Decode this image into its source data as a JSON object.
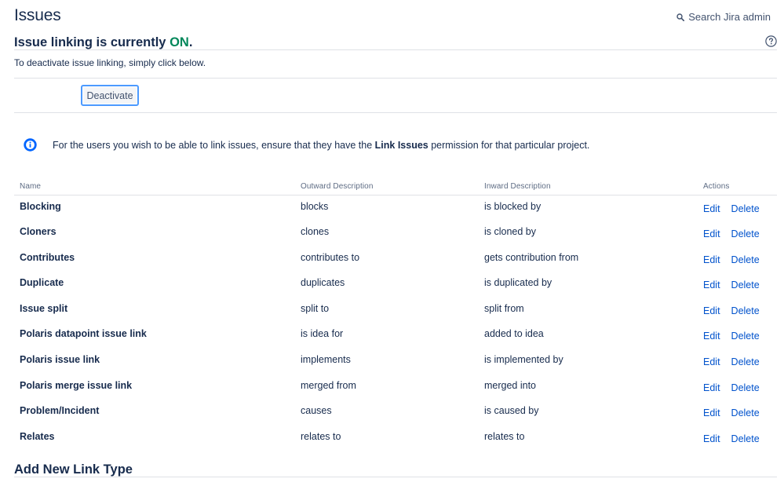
{
  "header": {
    "title": "Issues",
    "search_label": "Search Jira admin",
    "search_icon": "search-icon"
  },
  "linking": {
    "heading_prefix": "Issue linking is currently ",
    "status": "ON",
    "heading_suffix": ".",
    "status_color": "#00875a",
    "help_icon": "question-circle-icon",
    "instruction": "To deactivate issue linking, simply click below.",
    "deactivate_label": "Deactivate"
  },
  "info": {
    "icon": "info-circle-icon",
    "text_before": "For the users you wish to be able to link issues, ensure that they have the ",
    "permission": "Link Issues",
    "text_after": " permission for that particular project."
  },
  "table": {
    "columns": {
      "name": "Name",
      "outward": "Outward Description",
      "inward": "Inward Description",
      "actions": "Actions"
    },
    "edit_label": "Edit",
    "delete_label": "Delete",
    "rows": [
      {
        "name": "Blocking",
        "outward": "blocks",
        "inward": "is blocked by"
      },
      {
        "name": "Cloners",
        "outward": "clones",
        "inward": "is cloned by"
      },
      {
        "name": "Contributes",
        "outward": "contributes to",
        "inward": "gets contribution from"
      },
      {
        "name": "Duplicate",
        "outward": "duplicates",
        "inward": "is duplicated by"
      },
      {
        "name": "Issue split",
        "outward": "split to",
        "inward": "split from"
      },
      {
        "name": "Polaris datapoint issue link",
        "outward": "is idea for",
        "inward": "added to idea"
      },
      {
        "name": "Polaris issue link",
        "outward": "implements",
        "inward": "is implemented by"
      },
      {
        "name": "Polaris merge issue link",
        "outward": "merged from",
        "inward": "merged into"
      },
      {
        "name": "Problem/Incident",
        "outward": "causes",
        "inward": "is caused by"
      },
      {
        "name": "Relates",
        "outward": "relates to",
        "inward": "relates to"
      }
    ]
  },
  "add_section": {
    "heading": "Add New Link Type"
  },
  "colors": {
    "text": "#172b4d",
    "link": "#0052cc",
    "info_icon": "#0065ff",
    "button_focus": "#4c9aff",
    "divider": "#dfe1e6"
  }
}
